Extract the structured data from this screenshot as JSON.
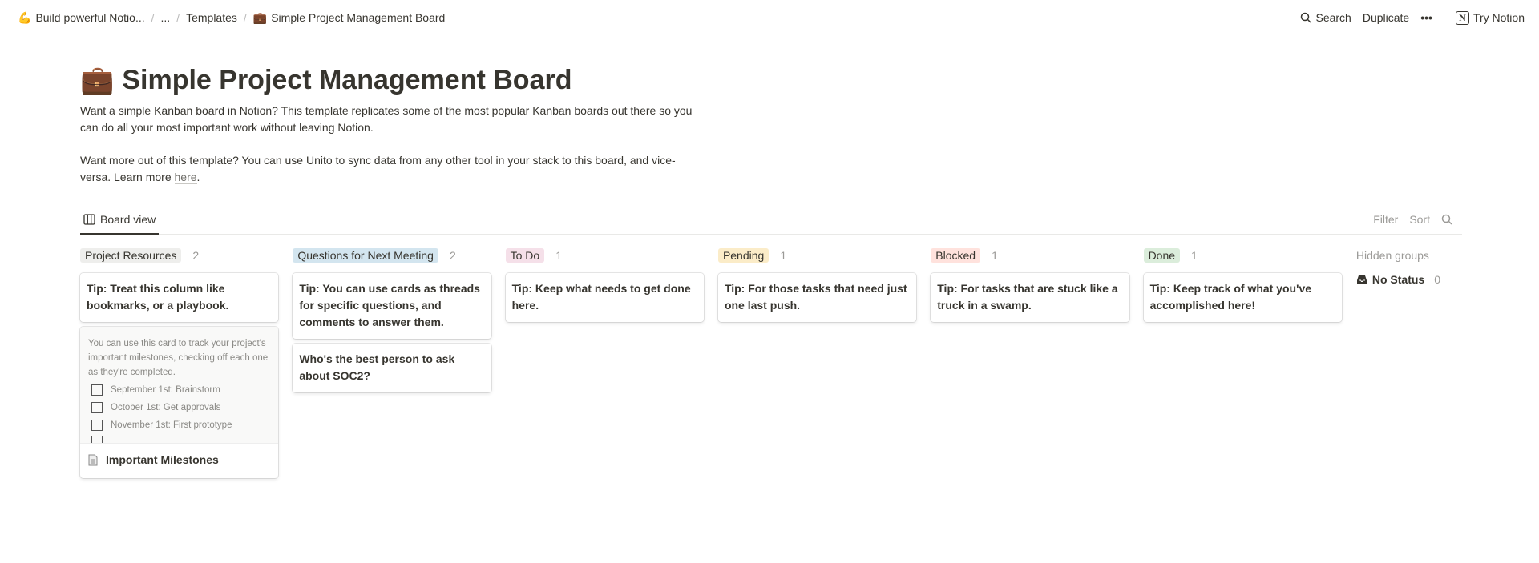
{
  "breadcrumb": [
    {
      "label": "Build powerful Notio...",
      "icon": "flexed-biceps-icon"
    },
    {
      "label": "..."
    },
    {
      "label": "Templates"
    },
    {
      "label": "Simple Project Management Board",
      "icon": "briefcase-icon"
    }
  ],
  "topbar": {
    "search": "Search",
    "duplicate": "Duplicate",
    "more": "•••",
    "try": "Try Notion"
  },
  "page": {
    "title": "Simple Project Management Board",
    "icon": "briefcase-icon",
    "desc1": "Want a simple Kanban board in Notion? This template replicates some of the most popular Kanban boards out there so you can do all your most important work without leaving Notion.",
    "desc2": "Want more out of this template? You can use Unito to sync data from any other tool in your stack to this board, and vice-versa. Learn more ",
    "link": "here",
    "period": "."
  },
  "view": {
    "tab": "Board view",
    "filter": "Filter",
    "sort": "Sort"
  },
  "columns": [
    {
      "name": "Project Resources",
      "count": "2",
      "color": "#eeeeec",
      "cards": [
        "Tip: Treat this column like bookmarks, or a playbook."
      ]
    },
    {
      "name": "Questions for Next Meeting",
      "count": "2",
      "color": "#d3e5ef",
      "cards": [
        "Tip: You can use cards as threads for specific questions, and comments to answer them.",
        "Who's the best person to ask about SOC2?"
      ]
    },
    {
      "name": "To Do",
      "count": "1",
      "color": "#f5e0e9",
      "cards": [
        "Tip: Keep what needs to get done here."
      ]
    },
    {
      "name": "Pending",
      "count": "1",
      "color": "#fbecc8",
      "cards": [
        "Tip: For those tasks that need just one last push."
      ]
    },
    {
      "name": "Blocked",
      "count": "1",
      "color": "#ffe2dd",
      "cards": [
        "Tip: For tasks that are stuck like a truck in a swamp."
      ]
    },
    {
      "name": "Done",
      "count": "1",
      "color": "#dbeddb",
      "cards": [
        "Tip: Keep track of what you've accomplished here!"
      ]
    }
  ],
  "milestones": {
    "preview": "You can use this card to track your project's important milestones, checking off each one as they're completed.",
    "items": [
      "September 1st: Brainstorm",
      "October 1st: Get approvals",
      "November 1st: First prototype"
    ],
    "title": "Important Milestones"
  },
  "hidden": {
    "label": "Hidden groups",
    "item": "No Status",
    "count": "0"
  }
}
